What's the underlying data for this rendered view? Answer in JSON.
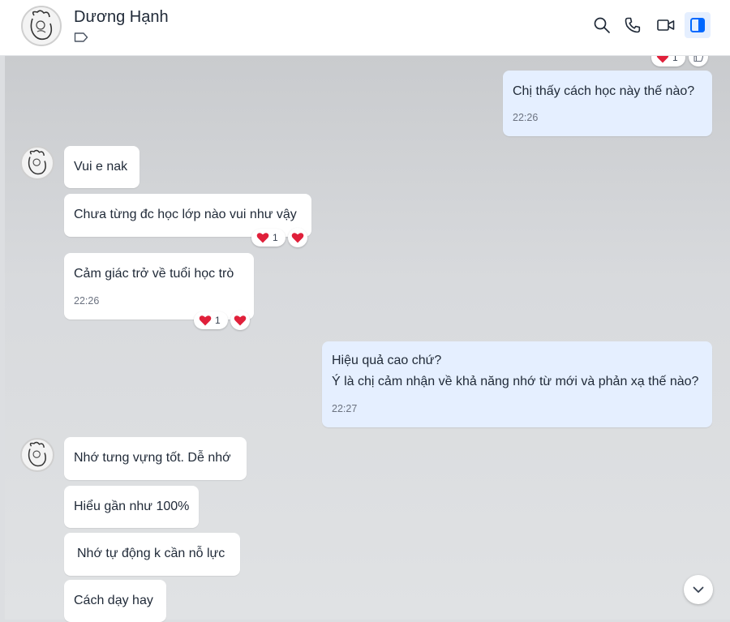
{
  "contact": {
    "name": "Dương Hạnh"
  },
  "header_icons": [
    "search-icon",
    "phone-icon",
    "video-icon",
    "side-panel-icon"
  ],
  "colors": {
    "accent": "#0068ff",
    "my_bubble": "#e5efff",
    "heart": "#e0203a"
  },
  "messages": [
    {
      "sender": "me",
      "lines": [
        "Chị thấy cách học này thế nào?"
      ],
      "time": "22:26"
    },
    {
      "sender": "contact",
      "lines": [
        "Vui e nak"
      ]
    },
    {
      "sender": "contact",
      "lines": [
        "Chưa từng đc học lớp nào vui như vậy"
      ],
      "reaction_count": "1"
    },
    {
      "sender": "contact",
      "lines": [
        "Cảm giác trở về tuổi học trò"
      ],
      "time": "22:26",
      "reaction_count": "1"
    },
    {
      "sender": "me",
      "lines": [
        "Hiệu quả cao chứ?",
        "Ý là chị cảm nhận về khả năng nhớ từ mới và phản xạ thế nào?"
      ],
      "time": "22:27"
    },
    {
      "sender": "contact",
      "lines": [
        "Nhớ tưng vựng tốt. Dễ nhớ"
      ]
    },
    {
      "sender": "contact",
      "lines": [
        "Hiểu gần như 100%"
      ]
    },
    {
      "sender": "contact",
      "lines": [
        "Nhớ tự động k cần nỗ lực"
      ]
    },
    {
      "sender": "contact",
      "lines": [
        "Cách dạy hay"
      ]
    }
  ],
  "top_partial_reaction": {
    "count": "1"
  }
}
